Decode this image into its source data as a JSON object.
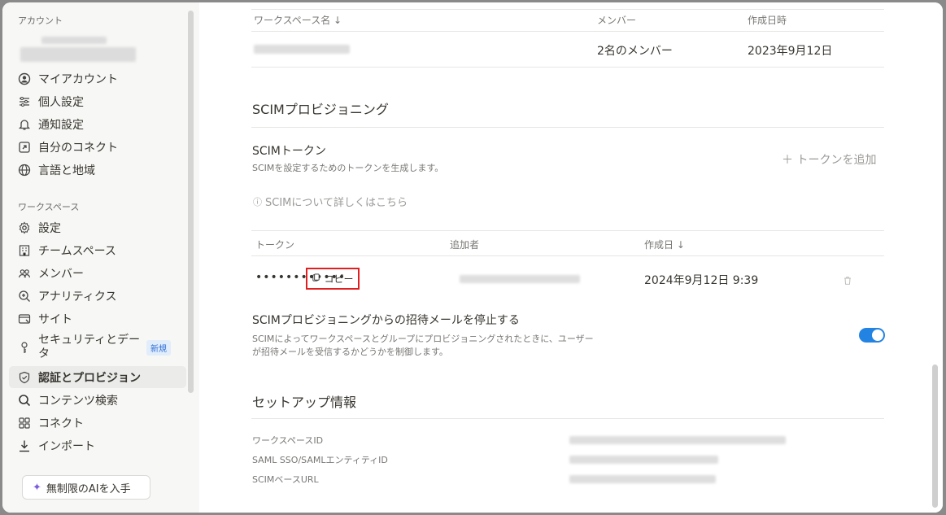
{
  "sidebar": {
    "account_section": "アカウント",
    "workspace_section": "ワークスペース",
    "account_items": [
      {
        "label": "マイアカウント",
        "icon": "account-circle-icon"
      },
      {
        "label": "個人設定",
        "icon": "sliders-icon"
      },
      {
        "label": "通知設定",
        "icon": "bell-icon"
      },
      {
        "label": "自分のコネクト",
        "icon": "external-link-icon"
      },
      {
        "label": "言語と地域",
        "icon": "globe-icon"
      }
    ],
    "workspace_items": [
      {
        "label": "設定",
        "icon": "gear-icon"
      },
      {
        "label": "チームスペース",
        "icon": "building-icon"
      },
      {
        "label": "メンバー",
        "icon": "members-icon"
      },
      {
        "label": "アナリティクス",
        "icon": "zoom-chart-icon"
      },
      {
        "label": "サイト",
        "icon": "site-icon"
      },
      {
        "label": "セキュリティとデータ",
        "icon": "key-icon"
      },
      {
        "label": "認証とプロビジョン",
        "icon": "shield-check-icon"
      },
      {
        "label": "コンテンツ検索",
        "icon": "search-icon"
      },
      {
        "label": "コネクト",
        "icon": "grid-icon"
      },
      {
        "label": "インポート",
        "icon": "download-icon"
      }
    ],
    "security_label_line1": "セキュリティとデー",
    "security_label_line2": "タ",
    "new_badge": "新規",
    "ai_button_label": "無制限のAIを入手"
  },
  "workspace_table": {
    "headers": {
      "name": "ワークスペース名 ↓",
      "members": "メンバー",
      "created": "作成日時"
    },
    "row": {
      "members": "2名のメンバー",
      "created": "2023年9月12日"
    }
  },
  "scim": {
    "title": "SCIMプロビジョニング",
    "token_title": "SCIMトークン",
    "token_desc": "SCIMを設定するためのトークンを生成します。",
    "add_token": "＋ トークンを追加",
    "help_link": "SCIMについて詳しくはこちら",
    "token_table": {
      "headers": {
        "token": "トークン",
        "added_by": "追加者",
        "created": "作成日 ↓"
      },
      "row": {
        "masked": "••••••••••••",
        "copy_label": "コピー",
        "created": "2024年9月12日 9:39"
      }
    },
    "invite_title": "SCIMプロビジョニングからの招待メールを停止する",
    "invite_desc_line1": "SCIMによってワークスペースとグループにプロビジョニングされたときに、ユーザー",
    "invite_desc_line2": "が招待メールを受信するかどうかを制御します。",
    "invite_toggle_on": true
  },
  "setup": {
    "title": "セットアップ情報",
    "labels": [
      "ワークスペースID",
      "SAML SSO/SAMLエンティティID",
      "SCIMベースURL"
    ]
  },
  "colors": {
    "accent": "#2383e2",
    "highlight": "#e02020"
  }
}
